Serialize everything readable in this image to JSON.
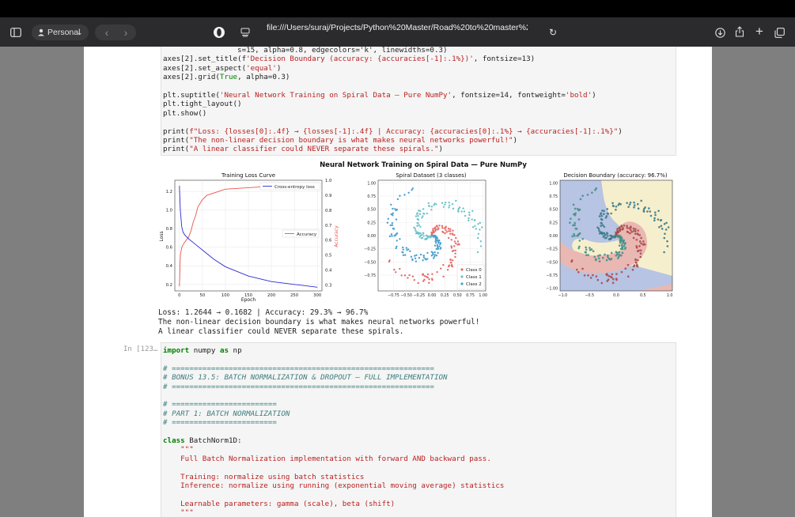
{
  "browser": {
    "profile_label": "Personal",
    "url": "file:///Users/suraj/Projects/Python%20Master/Road%20to%20master%20python/Py"
  },
  "code_top": {
    "line1": "                 s=15, alpha=0.8, edgecolors='k', linewidths=0.3)",
    "line2a": "axes[2].set_title(f",
    "line2b": "'Decision Boundary (accuracy: {accuracies[-1]:.1%})'",
    "line2c": ", fontsize=13)",
    "line3a": "axes[2].set_aspect(",
    "line3b": "'equal'",
    "line3c": ")",
    "line4a": "axes[2].grid(",
    "line4b": "True",
    "line4c": ", alpha=0.3)",
    "line5a": "plt.suptitle(",
    "line5b": "'Neural Network Training on Spiral Data — Pure NumPy'",
    "line5c": ", fontsize=14, fontweight=",
    "line5d": "'bold'",
    "line5e": ")",
    "line6": "plt.tight_layout()",
    "line7": "plt.show()",
    "line8a": "print(",
    "line8b": "f\"Loss: {losses[0]:.4f} → {losses[-1]:.4f} | Accuracy: {accuracies[0]:.1%} → {accuracies[-1]:.1%}\"",
    "line8c": ")",
    "line9a": "print(",
    "line9b": "\"The non-linear decision boundary is what makes neural networks powerful!\"",
    "line9c": ")",
    "line10a": "print(",
    "line10b": "\"A linear classifier could NEVER separate these spirals.\"",
    "line10c": ")"
  },
  "figure": {
    "suptitle": "Neural Network Training on Spiral Data — Pure NumPy",
    "left_title": "Training Loss Curve",
    "left_xlabel": "Epoch",
    "left_ylabel": "Loss",
    "left_y2label": "Accuracy",
    "legend_loss": "Cross-entropy loss",
    "legend_acc": "Accuracy",
    "mid_title": "Spiral Dataset (3 classes)",
    "right_title": "Decision Boundary (accuracy: 96.7%)",
    "class0": "Class 0",
    "class1": "Class 1",
    "class2": "Class 2"
  },
  "chart_data": [
    {
      "type": "line",
      "title": "Training Loss Curve",
      "xlabel": "Epoch",
      "ylabel": "Loss",
      "y2label": "Accuracy",
      "xlim": [
        -10,
        310
      ],
      "ylim": [
        0.13,
        1.32
      ],
      "y2lim": [
        0.26,
        1.0
      ],
      "x_ticks": [
        "0",
        "50",
        "100",
        "150",
        "200",
        "250",
        "300"
      ],
      "y_ticks": [
        "0.2",
        "0.4",
        "0.6",
        "0.8",
        "1.0",
        "1.2"
      ],
      "y2_ticks": [
        "0.3",
        "0.4",
        "0.5",
        "0.6",
        "0.7",
        "0.8",
        "0.9",
        "1.0"
      ],
      "series": [
        {
          "name": "Cross-entropy loss",
          "axis": "left",
          "color": "#2b2bd6",
          "x": [
            0,
            2,
            5,
            8,
            12,
            20,
            30,
            50,
            75,
            100,
            150,
            200,
            250,
            300
          ],
          "y": [
            1.26,
            1.0,
            0.82,
            0.76,
            0.73,
            0.69,
            0.65,
            0.57,
            0.47,
            0.39,
            0.29,
            0.23,
            0.2,
            0.17
          ]
        },
        {
          "name": "Accuracy",
          "axis": "right",
          "color": "#e8544c",
          "x": [
            0,
            2,
            5,
            10,
            15,
            20,
            25,
            30,
            35,
            40,
            50,
            60,
            80,
            100,
            150,
            200,
            250,
            300
          ],
          "y": [
            0.29,
            0.5,
            0.55,
            0.58,
            0.6,
            0.62,
            0.66,
            0.72,
            0.76,
            0.82,
            0.87,
            0.9,
            0.92,
            0.94,
            0.95,
            0.96,
            0.965,
            0.967
          ]
        }
      ]
    },
    {
      "type": "scatter",
      "title": "Spiral Dataset (3 classes)",
      "xlim": [
        -1.05,
        1.05
      ],
      "ylim": [
        -1.05,
        1.05
      ],
      "x_ticks": [
        "−0.75",
        "−0.50",
        "−0.25",
        "0.00",
        "0.25",
        "0.50",
        "0.75",
        "1.00"
      ],
      "y_ticks": [
        "1.00",
        "0.75",
        "0.50",
        "0.25",
        "0.00",
        "−0.25",
        "−0.50",
        "−0.75"
      ],
      "legend": "bottom-right",
      "series": [
        {
          "name": "Class 0",
          "color": "#e86a6a"
        },
        {
          "name": "Class 1",
          "color": "#6ac4c9"
        },
        {
          "name": "Class 2",
          "color": "#4aa0d0"
        }
      ]
    },
    {
      "type": "scatter",
      "title": "Decision Boundary (accuracy: 96.7%)",
      "xlim": [
        -1.05,
        1.05
      ],
      "ylim": [
        -1.05,
        1.05
      ],
      "x_ticks": [
        "−1.0",
        "−0.5",
        "0.0",
        "0.5",
        "1.0"
      ],
      "y_ticks": [
        "1.00",
        "0.75",
        "0.50",
        "0.25",
        "0.00",
        "−0.25",
        "−0.50",
        "−0.75",
        "−1.00"
      ]
    }
  ],
  "output": {
    "line1": "Loss: 1.2644 → 0.1682 | Accuracy: 29.3% → 96.7%",
    "line2": "The non-linear decision boundary is what makes neural networks powerful!",
    "line3": "A linear classifier could NEVER separate these spirals."
  },
  "cell2": {
    "prompt": "In [123…",
    "import_kw": "import",
    "import_mod": " numpy ",
    "as_kw": "as",
    "alias": " np",
    "sep1": "# ============================================================",
    "bonus": "# BONUS 13.5: BATCH NORMALIZATION & DROPOUT — FULL IMPLEMENTATION",
    "sep2": "# ============================================================",
    "sep3": "# ========================",
    "part1": "# PART 1: BATCH NORMALIZATION",
    "sep4": "# ========================",
    "class_kw": "class",
    "class_name": " BatchNorm1D:",
    "doc_open": "    \"\"\"",
    "doc1": "    Full Batch Normalization implementation with forward AND backward pass.",
    "doc2": "    Training: normalize using batch statistics",
    "doc3": "    Inference: normalize using running (exponential moving average) statistics",
    "doc4": "    Learnable parameters: gamma (scale), beta (shift)",
    "doc_close": "    \"\"\""
  }
}
